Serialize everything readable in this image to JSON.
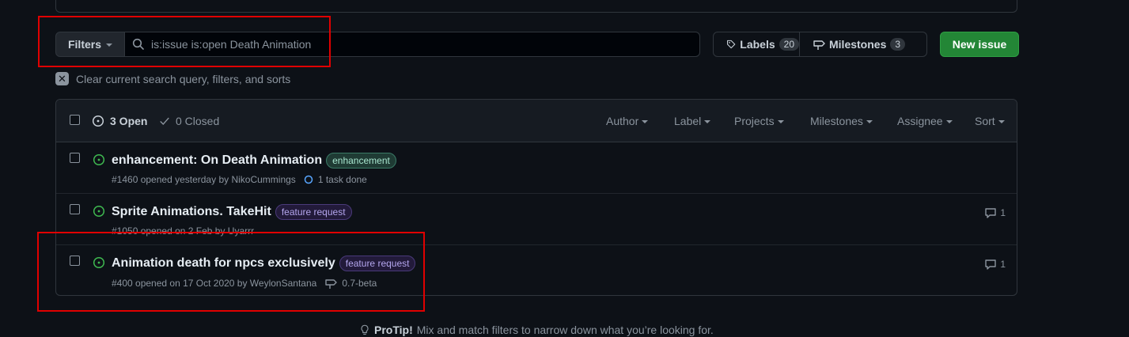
{
  "filters": {
    "button_label": "Filters",
    "search_value": "is:issue is:open Death Animation"
  },
  "toolbar": {
    "labels_label": "Labels",
    "labels_count": "20",
    "milestones_label": "Milestones",
    "milestones_count": "3",
    "new_issue_label": "New issue"
  },
  "clear": {
    "text": "Clear current search query, filters, and sorts"
  },
  "header": {
    "open_label": "3 Open",
    "closed_label": "0 Closed",
    "author": "Author",
    "label": "Label",
    "projects": "Projects",
    "milestones": "Milestones",
    "assignee": "Assignee",
    "sort": "Sort"
  },
  "issues": [
    {
      "title": "enhancement: On Death Animation",
      "label": "enhancement",
      "meta": "#1460 opened yesterday by NikoCummings",
      "extra": "1 task done",
      "comments": ""
    },
    {
      "title": "Sprite Animations. TakeHit",
      "label": "feature request",
      "meta": "#1050 opened on 2 Feb by Uyarrr",
      "extra": "",
      "comments": "1"
    },
    {
      "title": "Animation death for npcs exclusively",
      "label": "feature request",
      "meta": "#400 opened on 17 Oct 2020 by WeylonSantana",
      "extra": "0.7-beta",
      "comments": "1"
    }
  ],
  "protip": {
    "label": "ProTip!",
    "text": "Mix and match filters to narrow down what you’re looking for."
  },
  "colors": {
    "background": "#0d1117",
    "open_green": "#3fb950",
    "new_issue_green": "#238636",
    "annotation_red": "#e00000"
  }
}
